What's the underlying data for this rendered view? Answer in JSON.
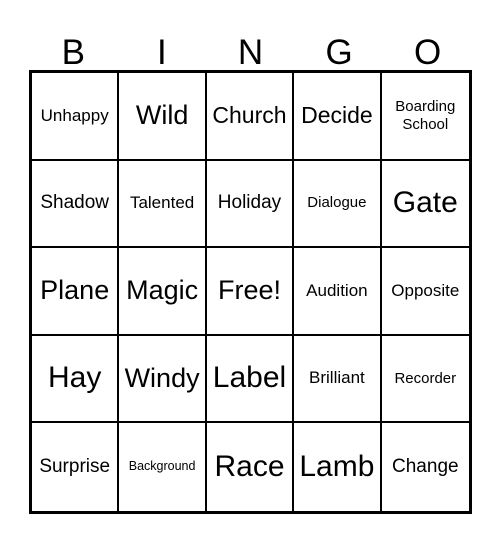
{
  "card": {
    "title": "BINGO",
    "header_letters": [
      "B",
      "I",
      "N",
      "G",
      "O"
    ],
    "colors": {
      "background": "#ffffff",
      "text": "#000000",
      "grid_line": "#000000",
      "outer_border": "#000000"
    },
    "grid": {
      "rows": 5,
      "columns": 5,
      "free_space_label": "Free!",
      "free_space_position": "center"
    },
    "cells": [
      [
        {
          "label": "Unhappy",
          "size": "sm",
          "lines": 1
        },
        {
          "label": "Wild",
          "size": "xl",
          "lines": 1
        },
        {
          "label": "Church",
          "size": "lg",
          "lines": 1
        },
        {
          "label": "Decide",
          "size": "lg",
          "lines": 1
        },
        {
          "label": "Boarding\nSchool",
          "size": "xs",
          "lines": 2
        }
      ],
      [
        {
          "label": "Shadow",
          "size": "md",
          "lines": 1
        },
        {
          "label": "Talented",
          "size": "sm",
          "lines": 1
        },
        {
          "label": "Holiday",
          "size": "md",
          "lines": 1
        },
        {
          "label": "Dialogue",
          "size": "xs",
          "lines": 1
        },
        {
          "label": "Gate",
          "size": "xxl",
          "lines": 1
        }
      ],
      [
        {
          "label": "Plane",
          "size": "xl",
          "lines": 1
        },
        {
          "label": "Magic",
          "size": "xl",
          "lines": 1
        },
        {
          "label": "Free!",
          "size": "xl",
          "lines": 1
        },
        {
          "label": "Audition",
          "size": "sm",
          "lines": 1
        },
        {
          "label": "Opposite",
          "size": "sm",
          "lines": 1
        }
      ],
      [
        {
          "label": "Hay",
          "size": "xxl",
          "lines": 1
        },
        {
          "label": "Windy",
          "size": "xl",
          "lines": 1
        },
        {
          "label": "Label",
          "size": "xxl",
          "lines": 1
        },
        {
          "label": "Brilliant",
          "size": "sm",
          "lines": 1
        },
        {
          "label": "Recorder",
          "size": "xs",
          "lines": 1
        }
      ],
      [
        {
          "label": "Surprise",
          "size": "md",
          "lines": 1
        },
        {
          "label": "Background",
          "size": "xxs",
          "lines": 1
        },
        {
          "label": "Race",
          "size": "xxl",
          "lines": 1
        },
        {
          "label": "Lamb",
          "size": "xxl",
          "lines": 1
        },
        {
          "label": "Change",
          "size": "md",
          "lines": 1
        }
      ]
    ]
  }
}
